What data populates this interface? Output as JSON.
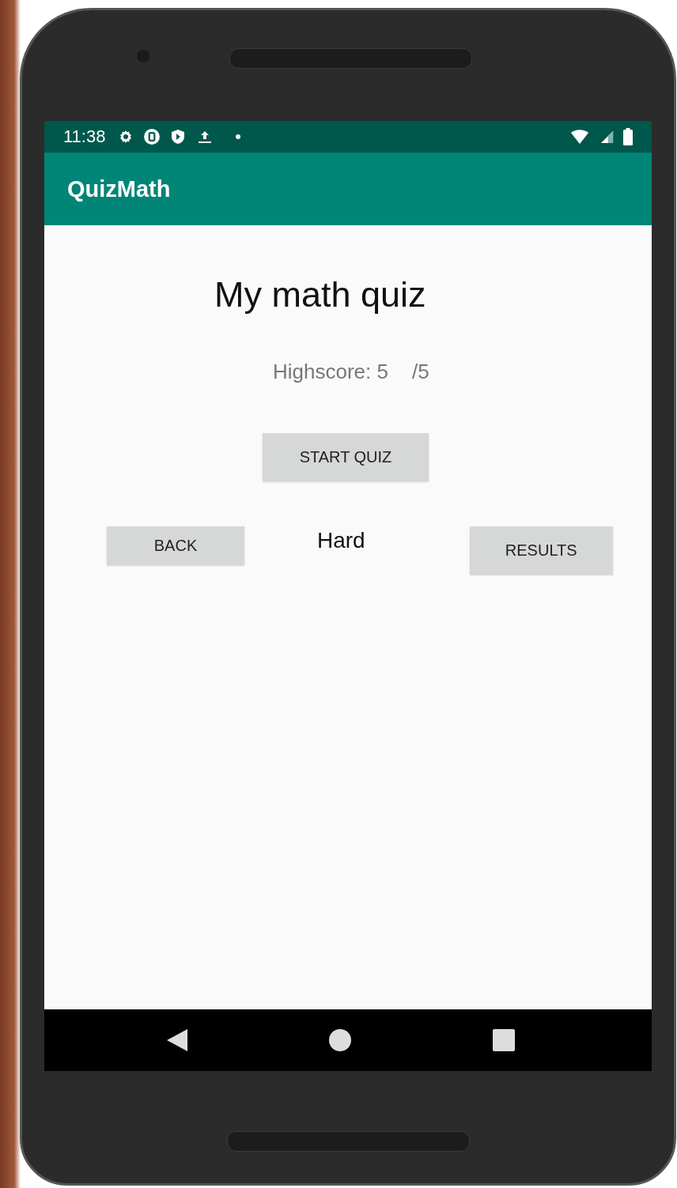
{
  "status_bar": {
    "time": "11:38"
  },
  "app_bar": {
    "title": "QuizMath"
  },
  "heading": "My math quiz",
  "highscore": {
    "label": "Highscore: 5",
    "total": "/5"
  },
  "start_button": "START QUIZ",
  "back_button": "BACK",
  "difficulty": "Hard",
  "results_button": "RESULTS"
}
